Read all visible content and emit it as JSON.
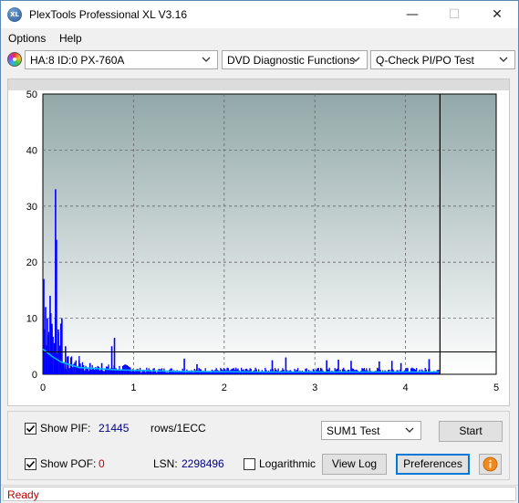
{
  "window": {
    "title": "PlexTools Professional XL V3.16",
    "icon_text": "XL",
    "controls": {
      "minimize": "—",
      "maximize": "☐",
      "close": "✕"
    }
  },
  "menu": {
    "options": "Options",
    "help": "Help"
  },
  "toolbar": {
    "drive": "HA:8 ID:0  PX-760A",
    "function": "DVD Diagnostic Functions",
    "test": "Q-Check PI/PO Test"
  },
  "chart_data": {
    "type": "bar",
    "description_series": [
      "PIF (blue bars)",
      "PIF average (cyan line)"
    ],
    "xlim": [
      0,
      5
    ],
    "ylim": [
      0,
      50
    ],
    "x_ticks": [
      "0",
      "1",
      "2",
      "3",
      "4",
      "5"
    ],
    "y_ticks": [
      "0",
      "10",
      "20",
      "30",
      "40",
      "50"
    ],
    "threshold_y": 4,
    "end_marker_x": 4.38,
    "grid": true,
    "colors": {
      "bars": "#0000ff",
      "average": "#00b4ff",
      "threshold": "#000000",
      "plot_top": "#92a8a8",
      "plot_bottom": "#ffffff"
    },
    "peaks": [
      {
        "x": 0.01,
        "y": 17
      },
      {
        "x": 0.03,
        "y": 12
      },
      {
        "x": 0.05,
        "y": 10
      },
      {
        "x": 0.08,
        "y": 14
      },
      {
        "x": 0.1,
        "y": 9
      },
      {
        "x": 0.14,
        "y": 33
      },
      {
        "x": 0.15,
        "y": 24
      },
      {
        "x": 0.17,
        "y": 8
      },
      {
        "x": 0.21,
        "y": 10
      },
      {
        "x": 0.25,
        "y": 5
      },
      {
        "x": 0.31,
        "y": 3
      },
      {
        "x": 0.4,
        "y": 2.5
      },
      {
        "x": 0.52,
        "y": 2
      },
      {
        "x": 0.65,
        "y": 2
      },
      {
        "x": 0.76,
        "y": 5
      },
      {
        "x": 0.79,
        "y": 6.5
      },
      {
        "x": 1.56,
        "y": 2.8
      },
      {
        "x": 1.7,
        "y": 1.8
      },
      {
        "x": 2.53,
        "y": 2.5
      },
      {
        "x": 2.68,
        "y": 3.0
      },
      {
        "x": 3.13,
        "y": 2.5
      },
      {
        "x": 3.26,
        "y": 2.6
      },
      {
        "x": 3.4,
        "y": 2.4
      },
      {
        "x": 3.71,
        "y": 2.3
      },
      {
        "x": 3.85,
        "y": 2.4
      },
      {
        "x": 3.95,
        "y": 2.0
      },
      {
        "x": 4.26,
        "y": 2.7
      }
    ],
    "average": [
      [
        0,
        4.5
      ],
      [
        0.1,
        3.2
      ],
      [
        0.2,
        2.2
      ],
      [
        0.4,
        1.2
      ],
      [
        0.8,
        0.8
      ],
      [
        1.5,
        0.5
      ],
      [
        2.5,
        0.4
      ],
      [
        3.5,
        0.4
      ],
      [
        4.38,
        0.4
      ]
    ]
  },
  "controls": {
    "show_pif_label": "Show PIF:",
    "pif_value": "21445",
    "rows_unit": "rows/1ECC",
    "show_pof_label": "Show POF:",
    "pof_value": "0",
    "lsn_label": "LSN:",
    "lsn_value": "2298496",
    "logarithmic_label": "Logarithmic",
    "sum_select": "SUM1 Test",
    "start": "Start",
    "view_log": "View Log",
    "preferences": "Preferences",
    "show_pif_checked": true,
    "show_pof_checked": true,
    "logarithmic_checked": false
  },
  "status": {
    "text": "Ready"
  }
}
